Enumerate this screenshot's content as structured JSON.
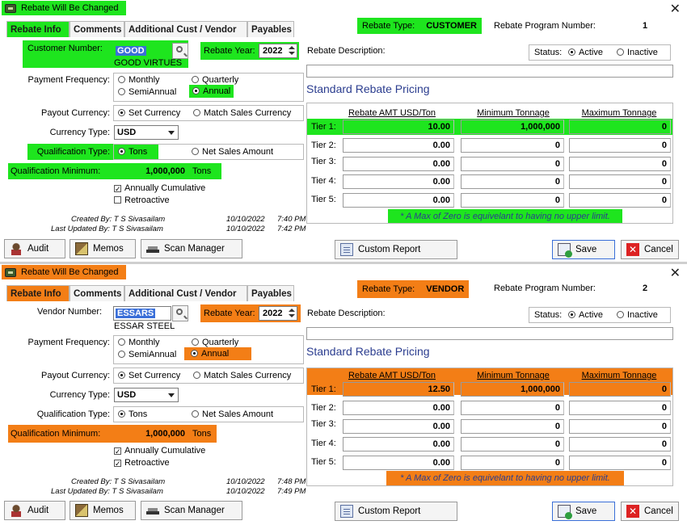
{
  "colors": {
    "hl1": "#1ee51e",
    "hl2": "#f37e16"
  },
  "windows": [
    {
      "title": "Rebate Will Be Changed",
      "close_glyph": "✕",
      "tabs": [
        "Rebate Info",
        "Comments",
        "Additional Cust / Vendor",
        "Payables"
      ],
      "rebate_type_label": "Rebate Type:",
      "rebate_type_value": "CUSTOMER",
      "program_label": "Rebate Program Number:",
      "program_value": "1",
      "party_label": "Customer Number:",
      "party_number": "GOOD",
      "party_name": "GOOD VIRTUES",
      "rebate_year_label": "Rebate Year:",
      "rebate_year": "2022",
      "rebate_desc_label": "Rebate Description:",
      "status_label": "Status:",
      "status_active": "Active",
      "status_inactive": "Inactive",
      "freq_label": "Payment Frequency:",
      "freq_monthly": "Monthly",
      "freq_quarterly": "Quarterly",
      "freq_semiannual": "SemiAnnual",
      "freq_annual": "Annual",
      "payout_label": "Payout Currency:",
      "payout_set": "Set Currency",
      "payout_match": "Match Sales Currency",
      "currency_label": "Currency Type:",
      "currency_value": "USD",
      "qual_type_label": "Qualification Type:",
      "qual_tons": "Tons",
      "qual_net": "Net Sales Amount",
      "qual_min_label": "Qualification Minimum:",
      "qual_min_value": "1,000,000",
      "qual_min_unit": "Tons",
      "annually_cumulative": "Annually Cumulative",
      "retroactive": "Retroactive",
      "annually_checked": true,
      "retro_checked": false,
      "created_label": "Created By: T S Sivasailam",
      "created_date": "10/10/2022",
      "created_time": "7:40 PM",
      "updated_label": "Last Updated By: T S Sivasailam",
      "updated_date": "10/10/2022",
      "updated_time": "7:42 PM",
      "pricing_title": "Standard Rebate Pricing",
      "col_rebate": "Rebate AMT USD/Ton",
      "col_min": "Minimum Tonnage",
      "col_max": "Maximum Tonnage",
      "tiers": [
        {
          "label": "Tier 1:",
          "amt": "10.00",
          "min": "1,000,000",
          "max": "0"
        },
        {
          "label": "Tier 2:",
          "amt": "0.00",
          "min": "0",
          "max": "0"
        },
        {
          "label": "Tier 3:",
          "amt": "0.00",
          "min": "0",
          "max": "0"
        },
        {
          "label": "Tier 4:",
          "amt": "0.00",
          "min": "0",
          "max": "0"
        },
        {
          "label": "Tier 5:",
          "amt": "0.00",
          "min": "0",
          "max": "0"
        }
      ],
      "note": "* A Max of Zero is equivelant to having no upper limit.",
      "buttons": {
        "audit": "Audit",
        "memos": "Memos",
        "scan": "Scan Manager",
        "report": "Custom Report",
        "save": "Save",
        "cancel": "Cancel"
      }
    },
    {
      "title": "Rebate Will Be Changed",
      "close_glyph": "✕",
      "tabs": [
        "Rebate Info",
        "Comments",
        "Additional Cust / Vendor",
        "Payables"
      ],
      "rebate_type_label": "Rebate Type:",
      "rebate_type_value": "VENDOR",
      "program_label": "Rebate Program Number:",
      "program_value": "2",
      "party_label": "Vendor Number:",
      "party_number": "ESSARS",
      "party_name": "ESSAR STEEL",
      "rebate_year_label": "Rebate Year:",
      "rebate_year": "2022",
      "rebate_desc_label": "Rebate Description:",
      "status_label": "Status:",
      "status_active": "Active",
      "status_inactive": "Inactive",
      "freq_label": "Payment Frequency:",
      "freq_monthly": "Monthly",
      "freq_quarterly": "Quarterly",
      "freq_semiannual": "SemiAnnual",
      "freq_annual": "Annual",
      "payout_label": "Payout Currency:",
      "payout_set": "Set Currency",
      "payout_match": "Match Sales Currency",
      "currency_label": "Currency Type:",
      "currency_value": "USD",
      "qual_type_label": "Qualification Type:",
      "qual_tons": "Tons",
      "qual_net": "Net Sales Amount",
      "qual_min_label": "Qualification Minimum:",
      "qual_min_value": "1,000,000",
      "qual_min_unit": "Tons",
      "annually_cumulative": "Annually Cumulative",
      "retroactive": "Retroactive",
      "annually_checked": true,
      "retro_checked": true,
      "created_label": "Created By: T S Sivasailam",
      "created_date": "10/10/2022",
      "created_time": "7:48 PM",
      "updated_label": "Last Updated By: T S Sivasailam",
      "updated_date": "10/10/2022",
      "updated_time": "7:49 PM",
      "pricing_title": "Standard Rebate Pricing",
      "col_rebate": "Rebate AMT USD/Ton",
      "col_min": "Minimum Tonnage",
      "col_max": "Maximum Tonnage",
      "tiers": [
        {
          "label": "Tier 1:",
          "amt": "12.50",
          "min": "1,000,000",
          "max": "0"
        },
        {
          "label": "Tier 2:",
          "amt": "0.00",
          "min": "0",
          "max": "0"
        },
        {
          "label": "Tier 3:",
          "amt": "0.00",
          "min": "0",
          "max": "0"
        },
        {
          "label": "Tier 4:",
          "amt": "0.00",
          "min": "0",
          "max": "0"
        },
        {
          "label": "Tier 5:",
          "amt": "0.00",
          "min": "0",
          "max": "0"
        }
      ],
      "note": "* A Max of Zero is equivelant to having no upper limit.",
      "buttons": {
        "audit": "Audit",
        "memos": "Memos",
        "scan": "Scan Manager",
        "report": "Custom Report",
        "save": "Save",
        "cancel": "Cancel"
      }
    }
  ]
}
